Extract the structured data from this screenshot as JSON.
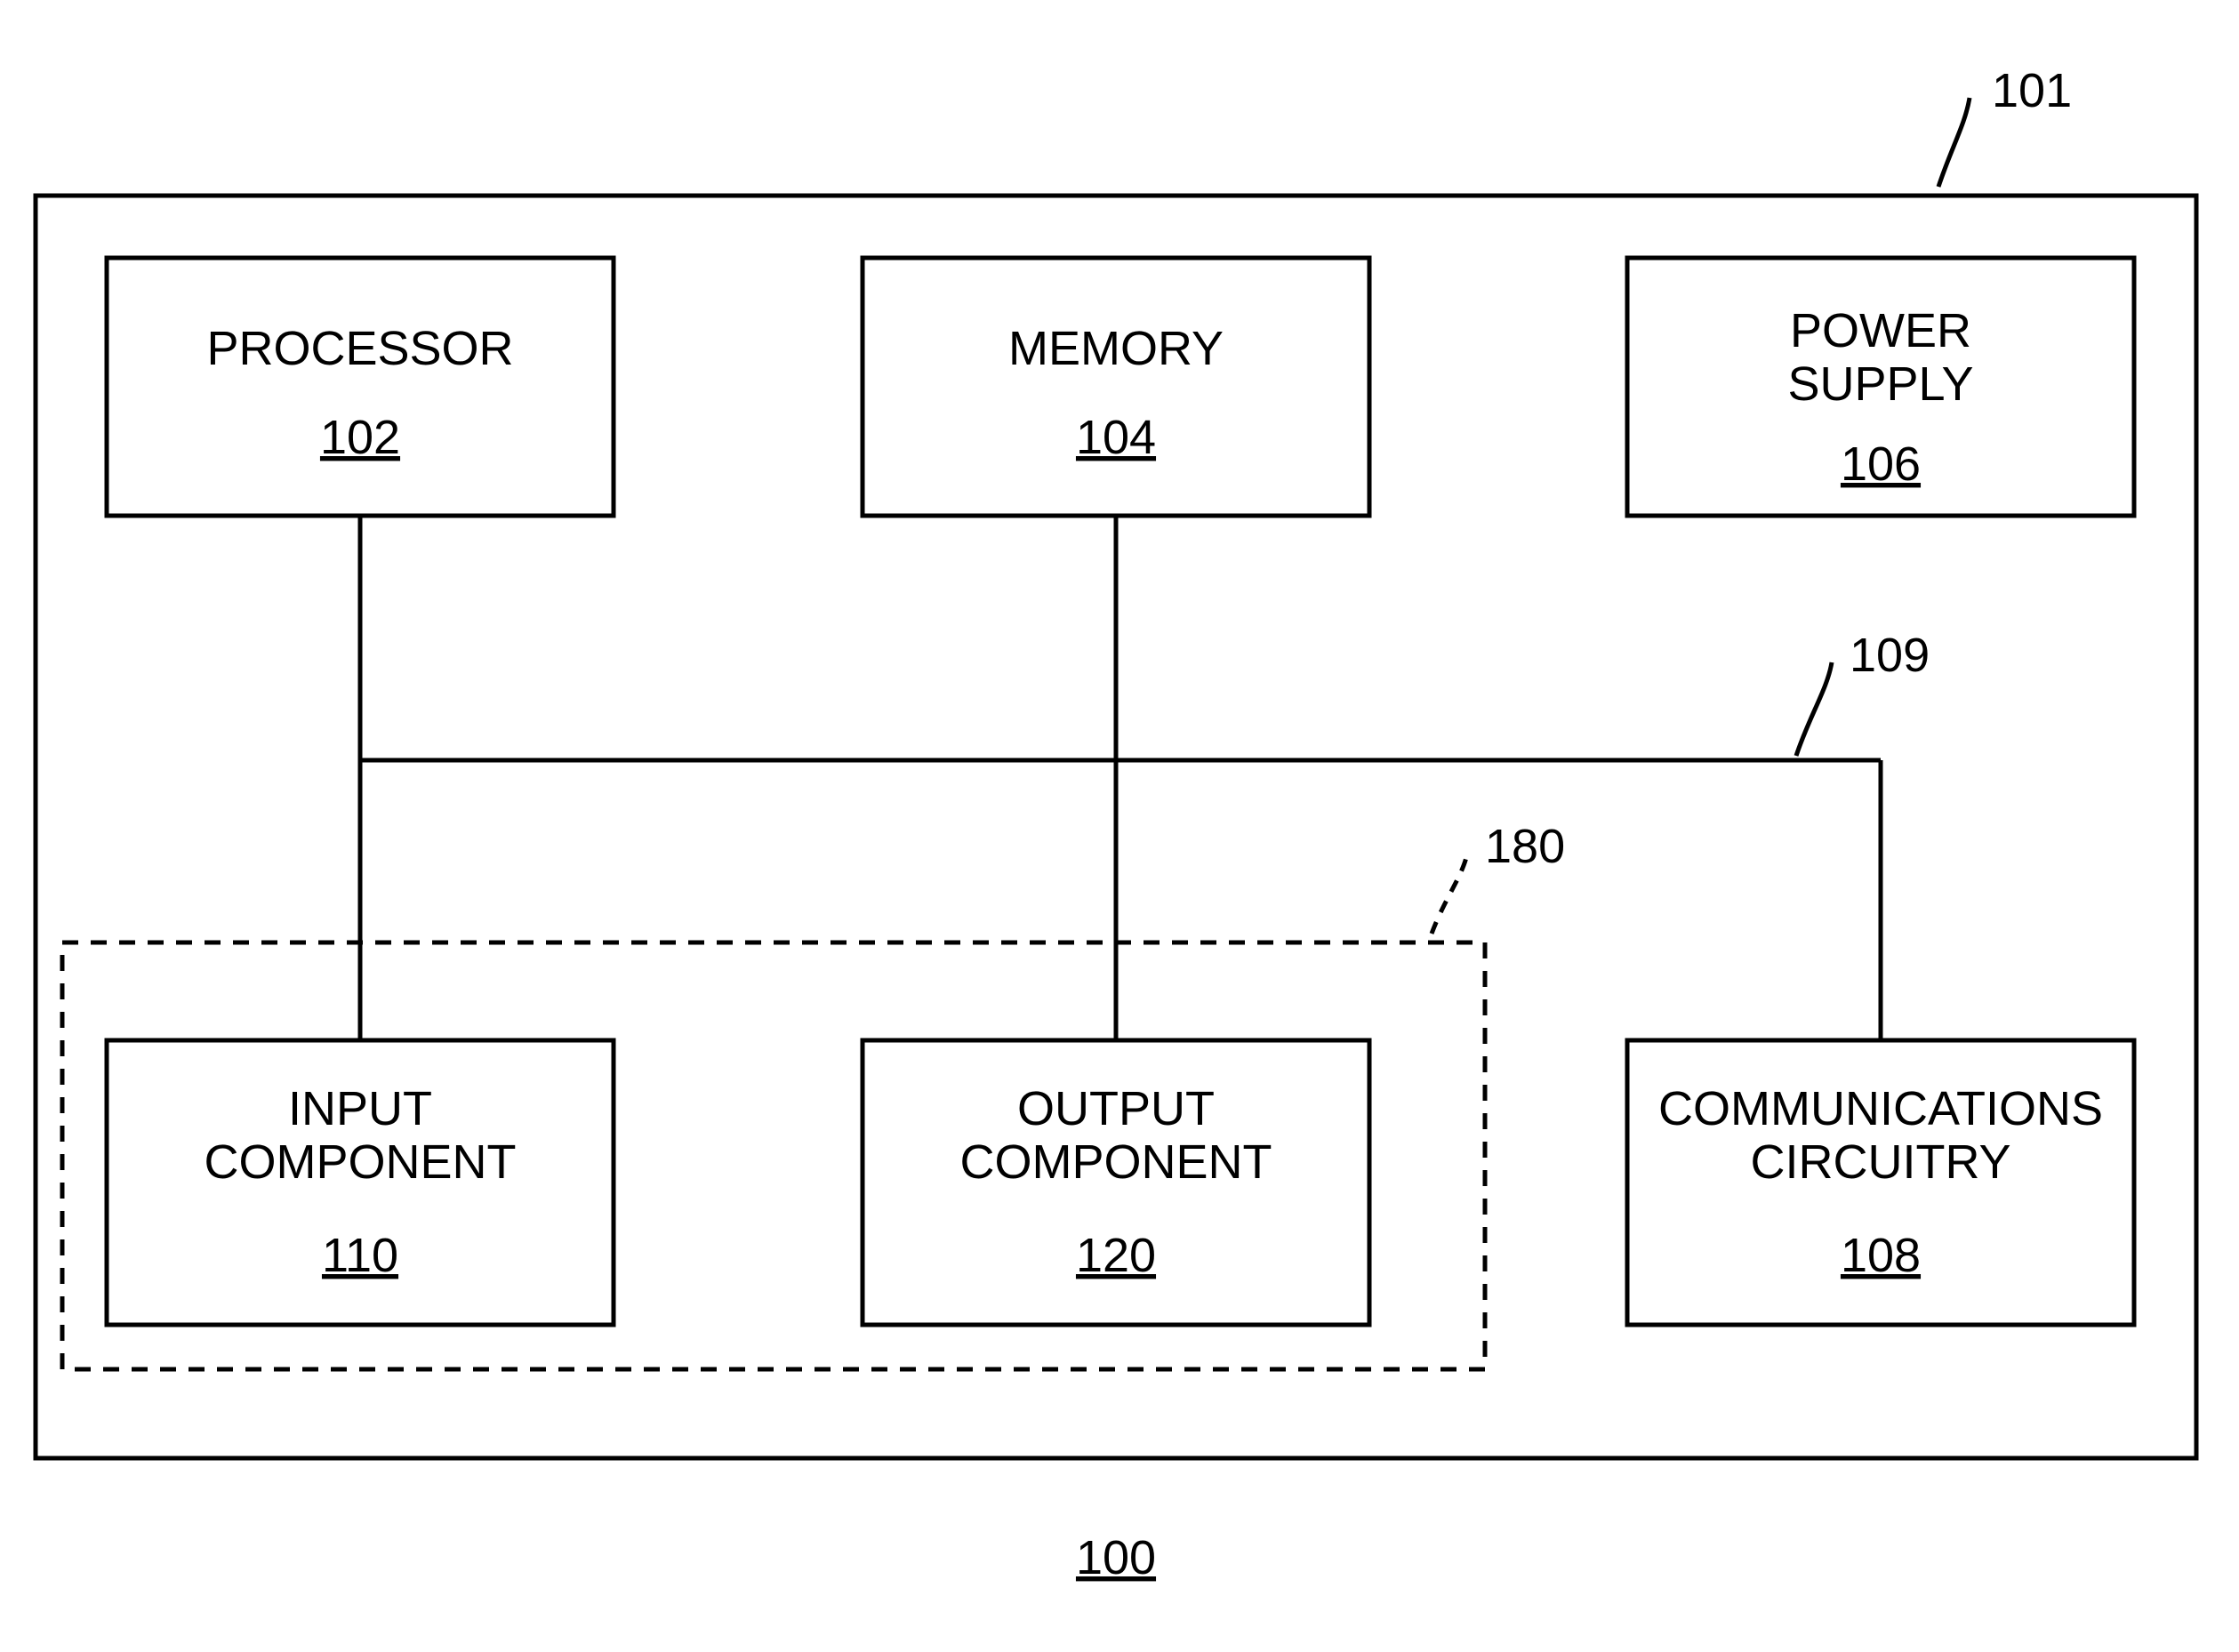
{
  "diagram": {
    "outer_ref": "101",
    "bus_ref": "109",
    "group_ref": "180",
    "figure_ref": "100",
    "blocks": {
      "processor": {
        "label": "PROCESSOR",
        "ref": "102"
      },
      "memory": {
        "label": "MEMORY",
        "ref": "104"
      },
      "power": {
        "label1": "POWER",
        "label2": "SUPPLY",
        "ref": "106"
      },
      "input": {
        "label1": "INPUT",
        "label2": "COMPONENT",
        "ref": "110"
      },
      "output": {
        "label1": "OUTPUT",
        "label2": "COMPONENT",
        "ref": "120"
      },
      "comms": {
        "label1": "COMMUNICATIONS",
        "label2": "CIRCUITRY",
        "ref": "108"
      }
    }
  }
}
